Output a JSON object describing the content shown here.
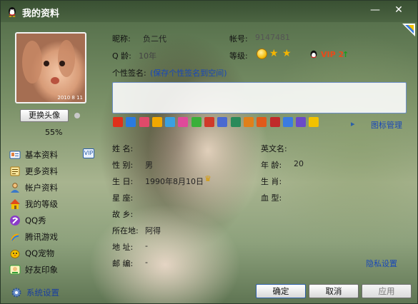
{
  "window": {
    "title": "我的资料",
    "minimize": "—",
    "close": "✕"
  },
  "avatar": {
    "stamp": "2010 8 11",
    "change_button": "更换头像",
    "completion": "55%"
  },
  "nav": {
    "items": [
      {
        "label": "基本资料",
        "icon": "id-card-icon"
      },
      {
        "label": "更多资料",
        "icon": "document-icon"
      },
      {
        "label": "帐户资料",
        "icon": "user-icon"
      },
      {
        "label": "我的等级",
        "icon": "house-icon"
      },
      {
        "label": "QQ秀",
        "icon": "qqshow-icon"
      },
      {
        "label": "腾讯游戏",
        "icon": "game-icon"
      },
      {
        "label": "QQ宠物",
        "icon": "pet-icon"
      },
      {
        "label": "好友印象",
        "icon": "impression-icon"
      }
    ],
    "badge": "VIP",
    "settings": "系统设置"
  },
  "profile": {
    "nickname_label": "昵称:",
    "nickname_value": "负二代",
    "account_label": "帐号:",
    "account_value": "9147481",
    "qage_label": "Q 龄:",
    "qage_value": "10年",
    "level_label": "等级:",
    "vip_text": "VIP 2",
    "vip_arrow": "↑",
    "signature_label": "个性签名:",
    "signature_link": "(保存个性签名到空间)",
    "icon_manage": "图标管理",
    "name_label": "姓    名:",
    "english_name_label": "英文名:",
    "gender_label": "性    别:",
    "gender_value": "男",
    "age_label": "年    龄:",
    "age_value": "20",
    "birthday_label": "生    日:",
    "birthday_value": "1990年8月10日",
    "zodiac_label": "生    肖:",
    "constellation_label": "星    座:",
    "blood_label": "血    型:",
    "hometown_label": "故    乡:",
    "location_label": "所在地:",
    "location_value": "阿得",
    "address_label": "地    址:",
    "address_value": "-",
    "postcode_label": "邮    编:",
    "postcode_value": "-",
    "privacy_link": "隐私设置"
  },
  "buttons": {
    "ok": "确定",
    "cancel": "取消",
    "apply": "应用"
  },
  "colors": {
    "link": "#1a48b8",
    "vip": "#e84a1a",
    "title_text": "#ffffff"
  }
}
